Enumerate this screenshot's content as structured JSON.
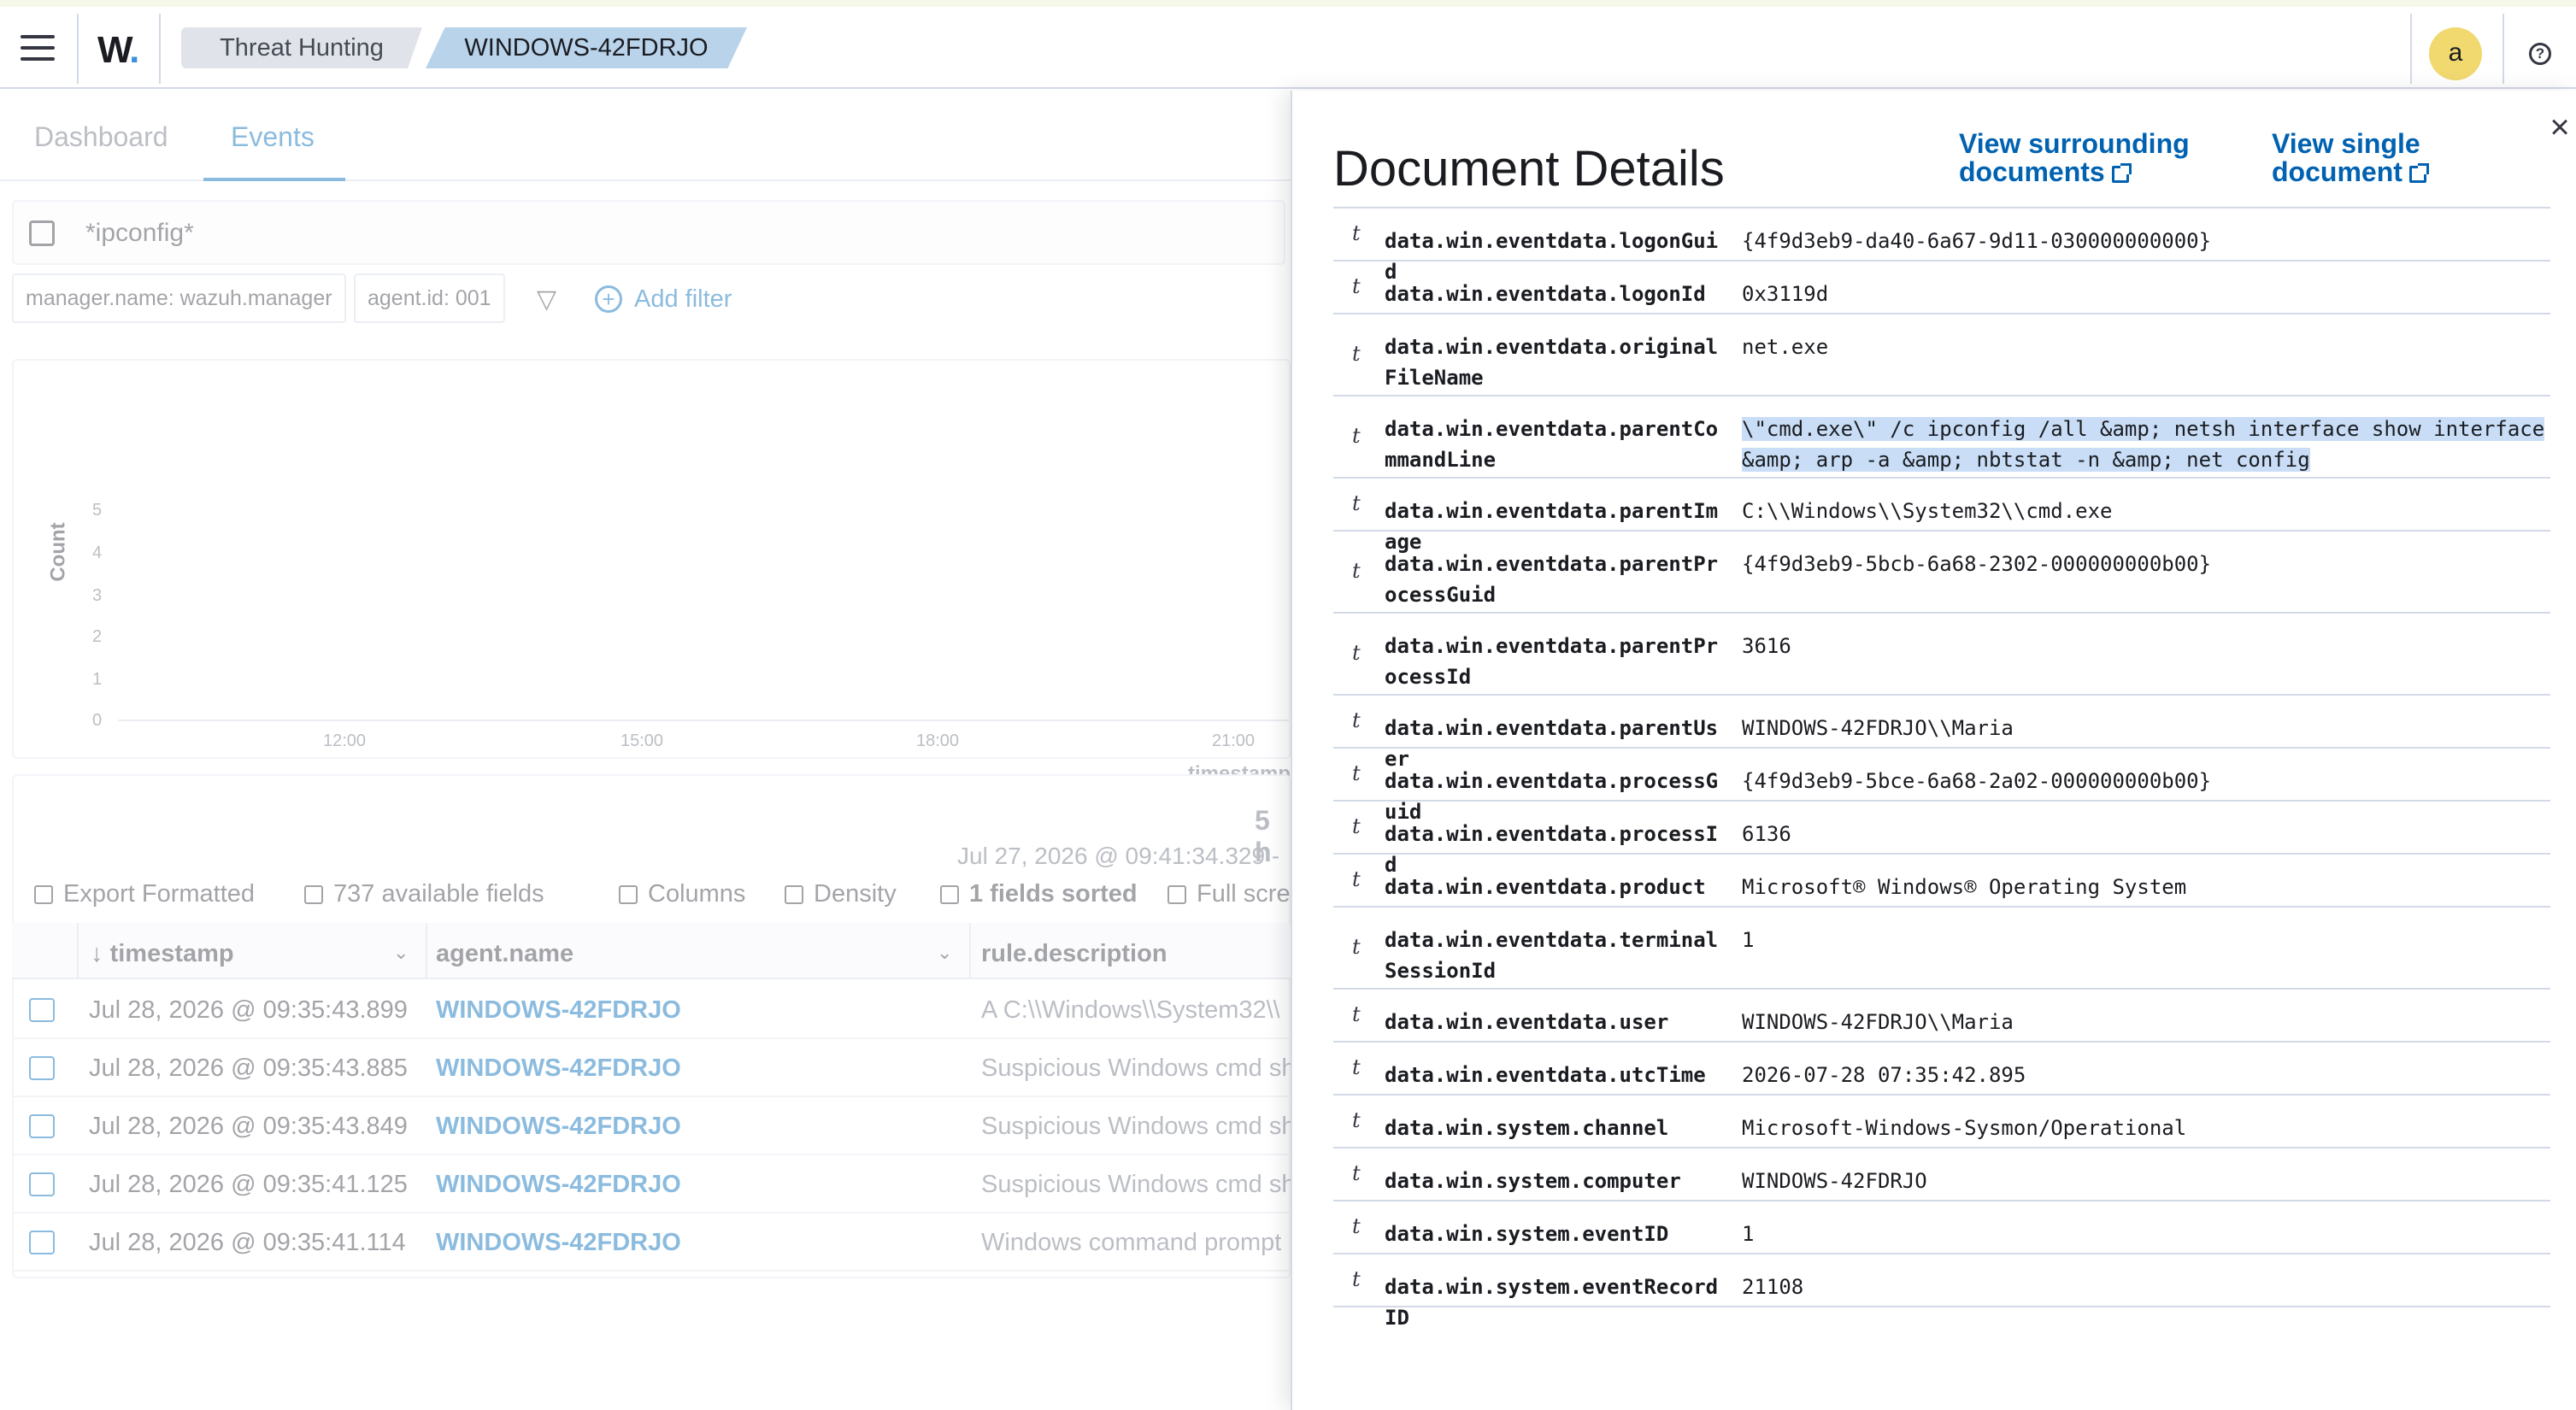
{
  "header": {
    "logo": "W",
    "breadcrumbs": [
      "Threat Hunting",
      "WINDOWS-42FDRJO"
    ],
    "avatar_letter": "a",
    "help_glyph": "?"
  },
  "tabs": [
    "Dashboard",
    "Events"
  ],
  "search": {
    "query": "*ipconfig*"
  },
  "filters": [
    "manager.name: wazuh.manager",
    "agent.id: 001"
  ],
  "add_filter_label": "Add filter",
  "histogram": {
    "ylabel": "Count",
    "xlabel": "timestamp",
    "yticks": [
      "5",
      "4",
      "3",
      "2",
      "1",
      "0"
    ],
    "xticks": [
      "12:00",
      "15:00",
      "18:00",
      "21:00"
    ]
  },
  "results": {
    "hits": "5 h",
    "date_range": "Jul 27, 2026 @ 09:41:34.329 -",
    "toolbar": [
      "Export Formatted",
      "737 available fields",
      "Columns",
      "Density",
      "1 fields sorted",
      "Full scre"
    ],
    "columns": [
      "timestamp",
      "agent.name",
      "rule.description"
    ],
    "rows": [
      {
        "timestamp": "Jul 28, 2026 @ 09:35:43.899",
        "agent": "WINDOWS-42FDRJO",
        "desc": "A C:\\\\Windows\\\\System32\\\\"
      },
      {
        "timestamp": "Jul 28, 2026 @ 09:35:43.885",
        "agent": "WINDOWS-42FDRJO",
        "desc": "Suspicious Windows cmd sh"
      },
      {
        "timestamp": "Jul 28, 2026 @ 09:35:43.849",
        "agent": "WINDOWS-42FDRJO",
        "desc": "Suspicious Windows cmd sh"
      },
      {
        "timestamp": "Jul 28, 2026 @ 09:35:41.125",
        "agent": "WINDOWS-42FDRJO",
        "desc": "Suspicious Windows cmd sh"
      },
      {
        "timestamp": "Jul 28, 2026 @ 09:35:41.114",
        "agent": "WINDOWS-42FDRJO",
        "desc": "Windows command prompt"
      }
    ]
  },
  "flyout": {
    "title": "Document Details",
    "link_surrounding": [
      "View surrounding",
      "documents"
    ],
    "link_single": [
      "View single",
      "document"
    ],
    "close_glyph": "×",
    "type_glyph": "t",
    "fields": [
      {
        "key": "data.win.eventdata.logonGuid",
        "value": "{4f9d3eb9-da40-6a67-9d11-030000000000}"
      },
      {
        "key": "data.win.eventdata.logonId",
        "value": "0x3119d"
      },
      {
        "key": "data.win.eventdata.originalFileName",
        "value": "net.exe"
      },
      {
        "key": "data.win.eventdata.parentCommandLine",
        "value": "\\\"cmd.exe\\\" /c ipconfig /all &amp; netsh interface show interface &amp; arp -a &amp; nbtstat -n &amp; net config"
      },
      {
        "key": "data.win.eventdata.parentImage",
        "value": "C:\\\\Windows\\\\System32\\\\cmd.exe"
      },
      {
        "key": "data.win.eventdata.parentProcessGuid",
        "value": "{4f9d3eb9-5bcb-6a68-2302-000000000b00}"
      },
      {
        "key": "data.win.eventdata.parentProcessId",
        "value": "3616"
      },
      {
        "key": "data.win.eventdata.parentUser",
        "value": "WINDOWS-42FDRJO\\\\Maria"
      },
      {
        "key": "data.win.eventdata.processGuid",
        "value": "{4f9d3eb9-5bce-6a68-2a02-000000000b00}"
      },
      {
        "key": "data.win.eventdata.processId",
        "value": "6136"
      },
      {
        "key": "data.win.eventdata.product",
        "value": "Microsoft® Windows® Operating System"
      },
      {
        "key": "data.win.eventdata.terminalSessionId",
        "value": "1"
      },
      {
        "key": "data.win.eventdata.user",
        "value": "WINDOWS-42FDRJO\\\\Maria"
      },
      {
        "key": "data.win.eventdata.utcTime",
        "value": "2026-07-28 07:35:42.895"
      },
      {
        "key": "data.win.system.channel",
        "value": "Microsoft-Windows-Sysmon/Operational"
      },
      {
        "key": "data.win.system.computer",
        "value": "WINDOWS-42FDRJO"
      },
      {
        "key": "data.win.system.eventID",
        "value": "1"
      },
      {
        "key": "data.win.system.eventRecordID",
        "value": "21108"
      }
    ]
  },
  "colors": {
    "accent": "#006bb8",
    "highlight": "#c9def6",
    "avatar": "#f1d86f",
    "breadcrumb_active": "#b9d3ea"
  }
}
